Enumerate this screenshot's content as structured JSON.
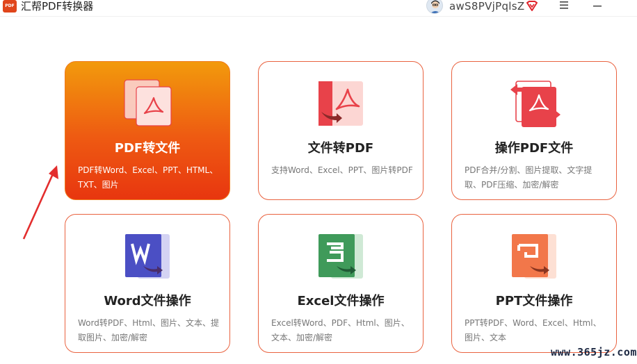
{
  "app": {
    "logo_text": "PDF",
    "title": "汇帮PDF转换器",
    "username": "awS8PVjPqlsZ"
  },
  "cards": [
    {
      "title": "PDF转文件",
      "desc": "PDF转Word、Excel、PPT、HTML、TXT、图片",
      "icon": "pdf-stack-icon",
      "active": true
    },
    {
      "title": "文件转PDF",
      "desc": "支持Word、Excel、PPT、图片转PDF",
      "icon": "pdf-convert-icon"
    },
    {
      "title": "操作PDF文件",
      "desc": "PDF合并/分割、图片提取、文字提取、PDF压缩、加密/解密",
      "icon": "pdf-operate-icon"
    },
    {
      "title": "Word文件操作",
      "desc": "Word转PDF、Html、图片、文本、提取图片、加密/解密",
      "icon": "word-icon"
    },
    {
      "title": "Excel文件操作",
      "desc": "Excel转Word、PDF、Html、图片、文本、加密/解密",
      "icon": "excel-icon"
    },
    {
      "title": "PPT文件操作",
      "desc": "PPT转PDF、Word、Excel、Html、图片、文本",
      "icon": "ppt-icon"
    }
  ],
  "colors": {
    "accent": "#e9623f",
    "active_gradient_top": "#f29a0c",
    "active_gradient_bottom": "#e8360f",
    "pdf_red": "#e8424a",
    "word_blue": "#4b4fc4",
    "excel_green": "#3f9a5a",
    "ppt_orange": "#f2774a"
  },
  "watermark": "www.365jz.com"
}
